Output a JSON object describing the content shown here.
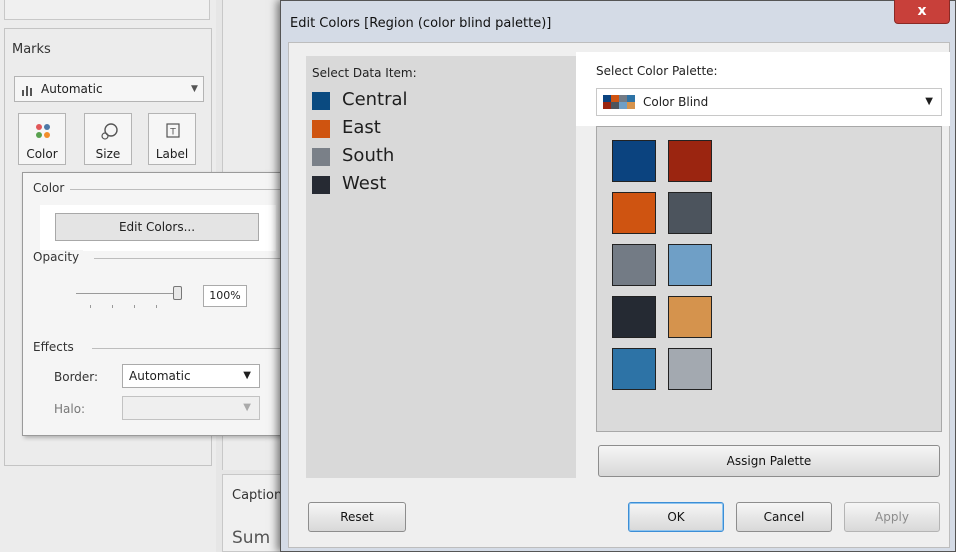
{
  "background": {
    "marks_title": "Marks",
    "mark_type": "Automatic",
    "mark_buttons": [
      {
        "label": "Color",
        "icon": "color-dots-icon"
      },
      {
        "label": "Size",
        "icon": "size-circle-icon"
      },
      {
        "label": "Label",
        "icon": "text-label-icon"
      }
    ],
    "caption_label": "Caption",
    "sum_label": "Sum"
  },
  "color_popup": {
    "color_heading": "Color",
    "edit_colors_label": "Edit Colors...",
    "opacity_heading": "Opacity",
    "opacity_value": "100%",
    "opacity_fraction": 1.0,
    "effects_heading": "Effects",
    "border_label": "Border:",
    "border_value": "Automatic",
    "halo_label": "Halo:",
    "halo_value": ""
  },
  "dialog": {
    "title": "Edit Colors [Region (color blind palette)]",
    "close_label": "x",
    "select_data_label": "Select Data Item:",
    "data_items": [
      {
        "label": "Central",
        "color": "#0a4a80"
      },
      {
        "label": "East",
        "color": "#cf5410"
      },
      {
        "label": "South",
        "color": "#7a8088"
      },
      {
        "label": "West",
        "color": "#262a33"
      }
    ],
    "select_palette_label": "Select Color Palette:",
    "palette_value": "Color Blind",
    "palette_colors": [
      "#0b437f",
      "#9b2510",
      "#cf5411",
      "#4c545d",
      "#737b85",
      "#6f9fc6",
      "#252a33",
      "#d5934d",
      "#2d73a6",
      "#a3a9b0"
    ],
    "assign_palette_label": "Assign Palette",
    "reset_label": "Reset",
    "ok_label": "OK",
    "cancel_label": "Cancel",
    "apply_label": "Apply"
  }
}
